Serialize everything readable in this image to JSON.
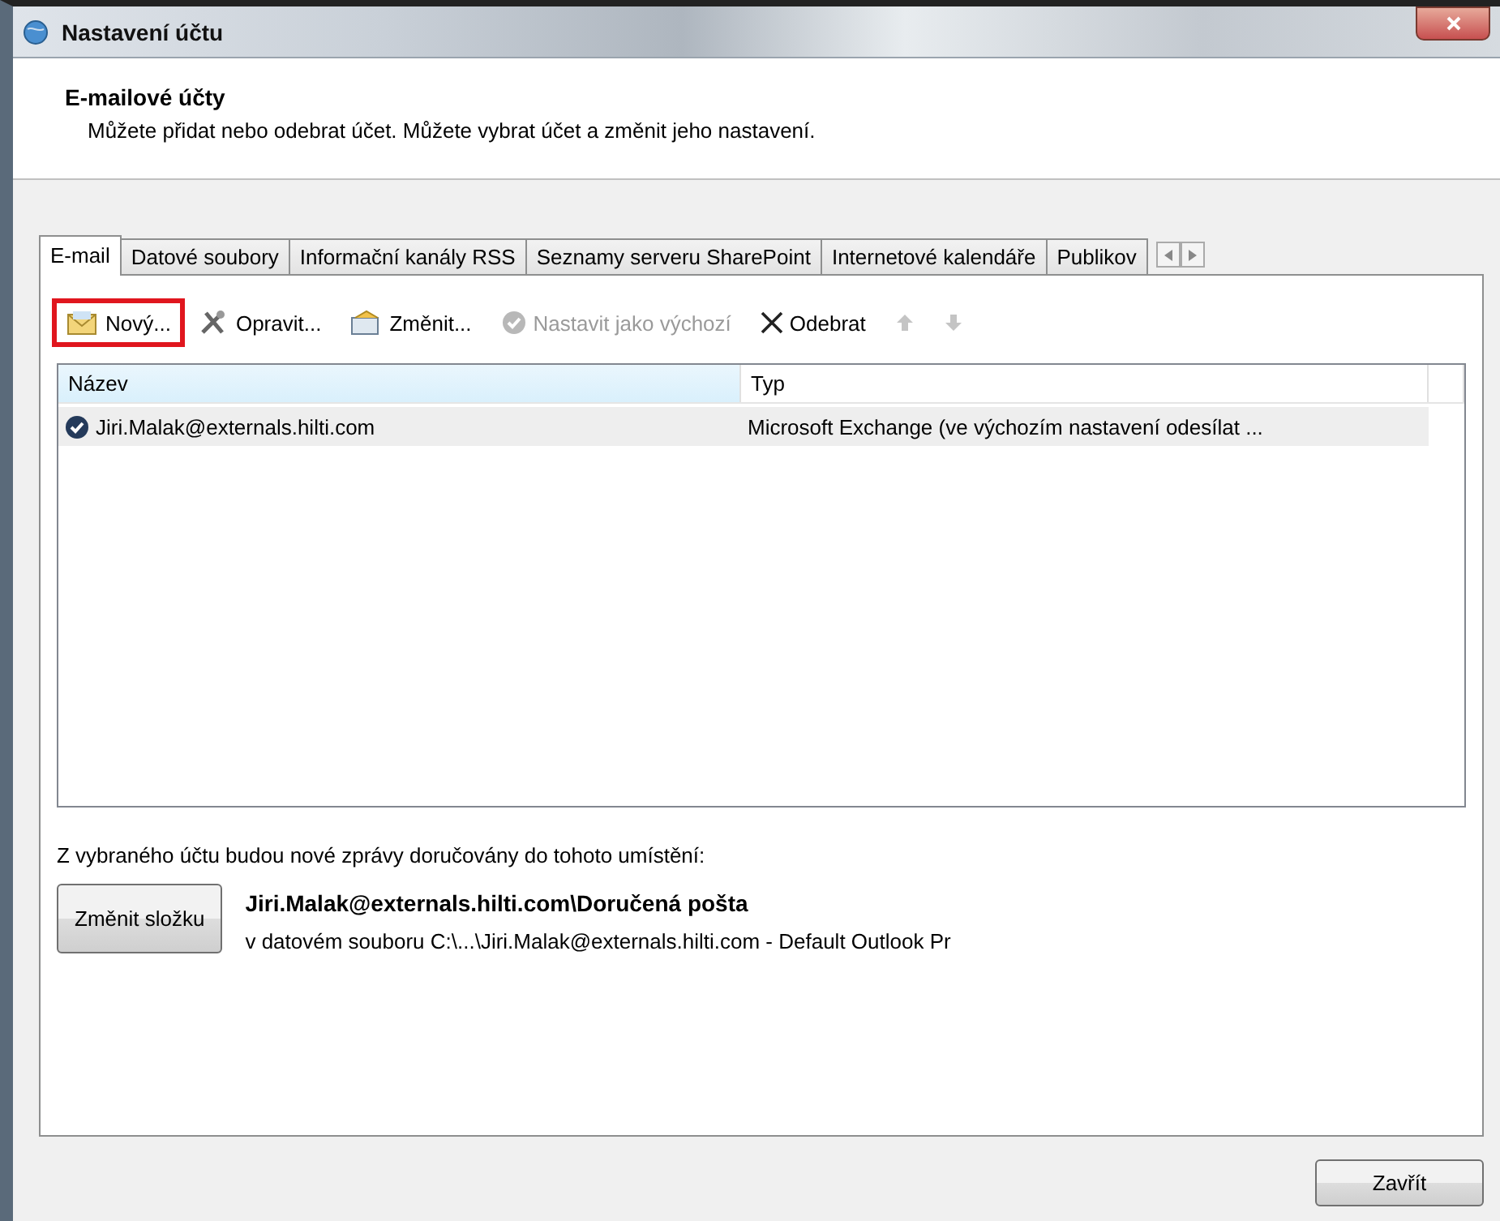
{
  "window": {
    "title": "Nastavení účtu"
  },
  "header": {
    "title": "E-mailové účty",
    "description": "Můžete přidat nebo odebrat účet. Můžete vybrat účet a změnit jeho nastavení."
  },
  "tabs": [
    {
      "label": "E-mail",
      "selected": true
    },
    {
      "label": "Datové soubory",
      "selected": false
    },
    {
      "label": "Informační kanály RSS",
      "selected": false
    },
    {
      "label": "Seznamy serveru SharePoint",
      "selected": false
    },
    {
      "label": "Internetové kalendáře",
      "selected": false
    },
    {
      "label": "Publikov",
      "selected": false
    }
  ],
  "toolbar": [
    {
      "kind": "new",
      "label": "Nový...",
      "disabled": false,
      "highlighted": true
    },
    {
      "kind": "repair",
      "label": "Opravit...",
      "disabled": false,
      "highlighted": false
    },
    {
      "kind": "change",
      "label": "Změnit...",
      "disabled": false,
      "highlighted": false
    },
    {
      "kind": "default",
      "label": "Nastavit jako výchozí",
      "disabled": true,
      "highlighted": false
    },
    {
      "kind": "remove",
      "label": "Odebrat",
      "disabled": false,
      "highlighted": false
    },
    {
      "kind": "up",
      "disabled": true,
      "highlighted": false
    },
    {
      "kind": "down",
      "disabled": true,
      "highlighted": false
    }
  ],
  "table": {
    "columns": [
      {
        "label": "Název",
        "sorted": true
      },
      {
        "label": "Typ",
        "sorted": false
      }
    ],
    "rows": [
      {
        "name": "Jiri.Malak@externals.hilti.com",
        "type": "Microsoft Exchange (ve výchozím nastavení odesílat ...",
        "selected": true
      }
    ]
  },
  "delivery": {
    "label": "Z vybraného účtu budou nové zprávy doručovány do tohoto umístění:",
    "button": "Změnit složku",
    "folder": "Jiri.Malak@externals.hilti.com\\Doručená pošta",
    "data_file": "v datovém souboru C:\\...\\Jiri.Malak@externals.hilti.com - Default Outlook Pr"
  },
  "buttons": [
    "Zavřít"
  ]
}
